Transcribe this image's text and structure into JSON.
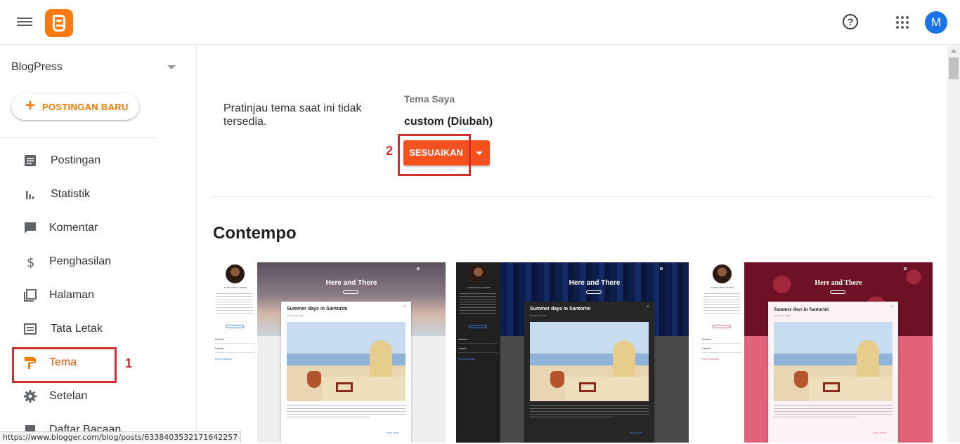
{
  "topbar": {
    "menu_icon": "hamburger-menu-icon",
    "logo_icon": "blogger-logo-icon",
    "help_icon": "help-circle-icon",
    "help_glyph": "?",
    "apps_icon": "apps-grid-icon",
    "avatar_letter": "M",
    "brand_color": "#ff7b0f",
    "avatar_color": "#1a73e8"
  },
  "sidebar": {
    "blog_name": "BlogPress",
    "new_post_plus": "+",
    "new_post_label": "POSTINGAN BARU",
    "items": [
      {
        "label": "Postingan",
        "icon": "posts-icon"
      },
      {
        "label": "Statistik",
        "icon": "stats-icon"
      },
      {
        "label": "Komentar",
        "icon": "comments-icon"
      },
      {
        "label": "Penghasilan",
        "icon": "dollar-icon"
      },
      {
        "label": "Halaman",
        "icon": "pages-icon"
      },
      {
        "label": "Tata Letak",
        "icon": "layout-icon"
      },
      {
        "label": "Tema",
        "icon": "theme-icon",
        "active": true
      },
      {
        "label": "Setelan",
        "icon": "gear-icon"
      },
      {
        "label": "Daftar Bacaan",
        "icon": "reading-list-icon"
      }
    ],
    "accent_color": "#e65100"
  },
  "annotations": {
    "marker_1": "1",
    "marker_2": "2",
    "color": "#d32f2f"
  },
  "main": {
    "preview_message": "Pratinjau tema saat ini tidak tersedia.",
    "my_theme_label": "Tema Saya",
    "theme_name": "custom (Diubah)",
    "customize_label": "SESUAIKAN",
    "customize_color": "#f4511e",
    "section_title": "Contempo",
    "cards": [
      {
        "variant": "light",
        "blog_title": "Here and There",
        "post_title": "Summer days in Santorini",
        "author": "ALEXANDRA HERMS",
        "date": "October 18, 2016",
        "archive": "Archive",
        "labels": "Labels",
        "report": "Report Abuse",
        "read_more": "READ MORE",
        "share_glyph": "<"
      },
      {
        "variant": "dark",
        "blog_title": "Here and There",
        "post_title": "Summer days in Santorini",
        "author": "ALEXANDRA HERMS",
        "date": "October 18, 2016",
        "archive": "Archive",
        "labels": "Labels",
        "report": "Report Abuse",
        "read_more": "READ MORE",
        "share_glyph": "<"
      },
      {
        "variant": "floral",
        "blog_title": "Here and There",
        "post_title": "Summer days in Santorini",
        "author": "ALEXANDRA HERMS",
        "date": "October 18, 2016",
        "archive": "Archive",
        "labels": "Labels",
        "report": "Report Abuse",
        "read_more": "READ MORE",
        "share_glyph": "<"
      }
    ]
  },
  "status_bar": {
    "url": "https://www.blogger.com/blog/posts/6338403532171642257"
  }
}
